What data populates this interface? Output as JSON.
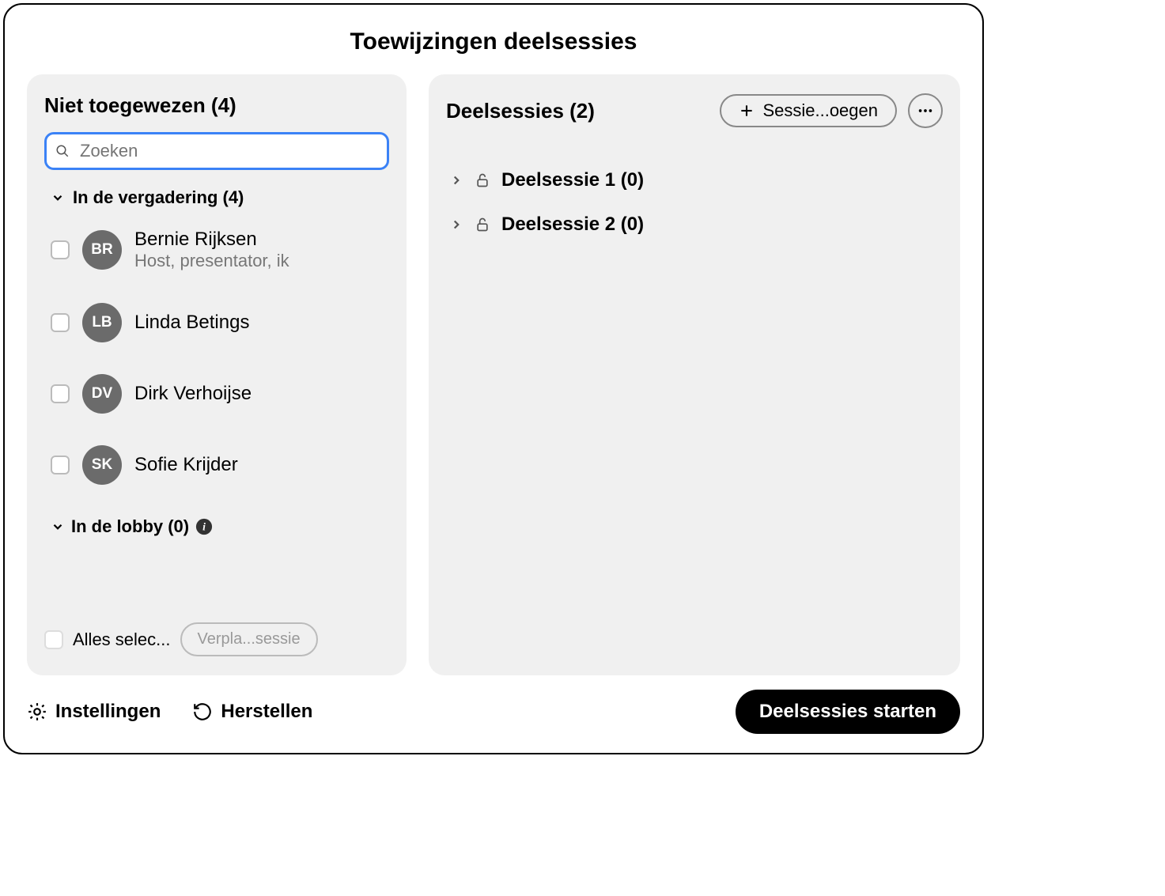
{
  "title": "Toewijzingen deelsessies",
  "left": {
    "title": "Niet toegewezen (4)",
    "search_placeholder": "Zoeken",
    "meeting_section": "In de vergadering (4)",
    "people": [
      {
        "initials": "BR",
        "name": "Bernie Rijksen",
        "sub": "Host, presentator, ik"
      },
      {
        "initials": "LB",
        "name": "Linda Betings",
        "sub": ""
      },
      {
        "initials": "DV",
        "name": "Dirk Verhoijse",
        "sub": ""
      },
      {
        "initials": "SK",
        "name": "Sofie Krijder",
        "sub": ""
      }
    ],
    "lobby_section": "In de lobby (0)",
    "select_all": "Alles selec...",
    "move_btn": "Verpla...sessie"
  },
  "right": {
    "title": "Deelsessies (2)",
    "add_btn": "Sessie...oegen",
    "sessions": [
      {
        "label": "Deelsessie 1 (0)"
      },
      {
        "label": "Deelsessie 2 (0)"
      }
    ]
  },
  "footer": {
    "settings": "Instellingen",
    "reset": "Herstellen",
    "start": "Deelsessies starten"
  }
}
